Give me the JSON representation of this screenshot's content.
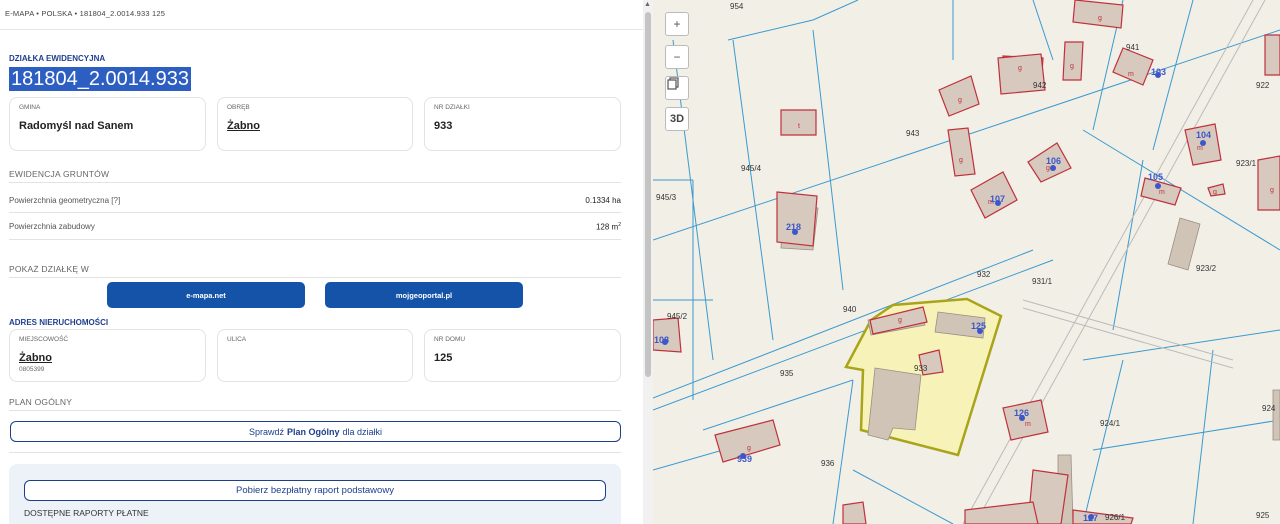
{
  "breadcrumb": "E-MAPA • POLSKA • 181804_2.0014.933 125",
  "parcel": {
    "heading": "DZIAŁKA EWIDENCYJNA",
    "id": "181804_2.0014.933",
    "gmina_label": "GMINA",
    "gmina_value": "Radomyśl nad Sanem",
    "obreb_label": "OBRĘB",
    "obreb_value": "Żabno",
    "nr_label": "NR DZIAŁKI",
    "nr_value": "933"
  },
  "ewidencja": {
    "title": "EWIDENCJA GRUNTÓW",
    "geom_label": "Powierzchnia geometryczna [?]",
    "geom_value": "0.1334 ha",
    "zab_label": "Powierzchnia zabudowy",
    "zab_value": "128 m",
    "zab_unit_sup": "2"
  },
  "show_in": {
    "title": "POKAŻ DZIAŁKĘ W",
    "btn1": "e-mapa.net",
    "btn2": "mojgeoportal.pl"
  },
  "address": {
    "heading": "ADRES NIERUCHOMOŚCI",
    "city_label": "MIEJSCOWOŚĆ",
    "city_value": "Żabno",
    "city_code": "0805399",
    "street_label": "ULICA",
    "house_label": "NR DOMU",
    "house_value": "125"
  },
  "plan": {
    "title": "PLAN OGÓLNY",
    "btn_prefix": "Sprawdź",
    "btn_bold": "Plan Ogólny",
    "btn_suffix": "dla działki"
  },
  "reports": {
    "free_btn": "Pobierz bezpłatny raport podstawowy",
    "paid_title": "DOSTĘPNE RAPORTY PŁATNE"
  },
  "map": {
    "controls": {
      "zoom_in": "+",
      "zoom_out": "−",
      "layers": "layers-icon",
      "three_d": "3D"
    },
    "parcel_labels": [
      "954",
      "941",
      "922",
      "942",
      "943",
      "945/4",
      "923/1",
      "945/3",
      "932",
      "931/1",
      "923/2",
      "940",
      "945/2",
      "935",
      "933",
      "924",
      "924/1",
      "936",
      "926/1",
      "925"
    ],
    "house_numbers": [
      "103",
      "104",
      "106",
      "105",
      "107",
      "218",
      "125",
      "108",
      "126",
      "939",
      "127"
    ],
    "building_letters": [
      "g",
      "t",
      "m"
    ],
    "colors": {
      "background": "#f2efe7",
      "parcel_line": "#3a9ad0",
      "building": "#c0303c",
      "selected_fill": "#f7f3b8",
      "selected_stroke": "#a9a41a"
    }
  }
}
